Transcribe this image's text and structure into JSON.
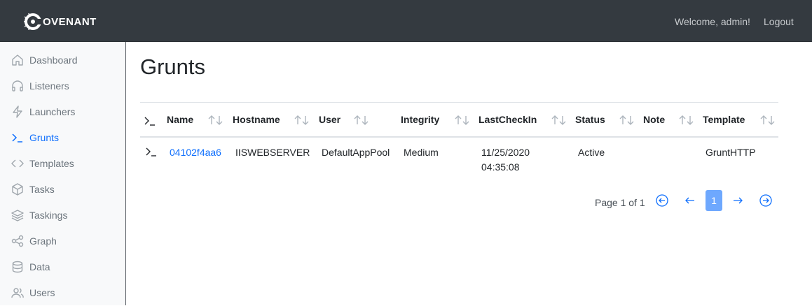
{
  "header": {
    "brand_text": "OVENANT",
    "welcome": "Welcome, admin!",
    "logout": "Logout"
  },
  "sidebar": {
    "items": [
      {
        "label": "Dashboard",
        "icon": "home-icon"
      },
      {
        "label": "Listeners",
        "icon": "headphones-icon"
      },
      {
        "label": "Launchers",
        "icon": "zap-icon"
      },
      {
        "label": "Grunts",
        "icon": "terminal-icon",
        "active": true
      },
      {
        "label": "Templates",
        "icon": "code-icon"
      },
      {
        "label": "Tasks",
        "icon": "box-icon"
      },
      {
        "label": "Taskings",
        "icon": "layers-icon"
      },
      {
        "label": "Graph",
        "icon": "share-icon"
      },
      {
        "label": "Data",
        "icon": "database-icon"
      },
      {
        "label": "Users",
        "icon": "users-icon"
      }
    ]
  },
  "main": {
    "title": "Grunts",
    "table": {
      "columns": [
        "Name",
        "Hostname",
        "User",
        "Integrity",
        "LastCheckIn",
        "Status",
        "Note",
        "Template"
      ],
      "rows": [
        {
          "name": "04102f4aa6",
          "hostname": "IISWEBSERVER",
          "user": "DefaultAppPool",
          "integrity": "Medium",
          "lastcheckin_date": "11/25/2020",
          "lastcheckin_time": "04:35:08",
          "status": "Active",
          "note": "",
          "template": "GruntHTTP"
        }
      ]
    },
    "pagination": {
      "text": "Page 1 of 1",
      "current": "1"
    }
  },
  "colors": {
    "topbar": "#343a40",
    "sidebar": "#f8f9fa",
    "link": "#0d6efd",
    "page_active": "#6ea8fe"
  }
}
